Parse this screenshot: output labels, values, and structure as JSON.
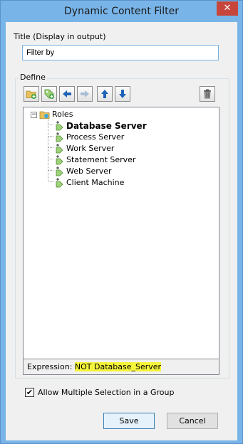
{
  "window": {
    "title": "Dynamic Content Filter",
    "close_glyph": "✕"
  },
  "title_field": {
    "label": "Title (Display in output)",
    "value": "Filter by"
  },
  "define": {
    "label": "Define",
    "toolbar": [
      {
        "name": "add-folder-button",
        "icon": "folder-add-icon"
      },
      {
        "name": "add-item-button",
        "icon": "tag-add-icon"
      },
      {
        "name": "move-left-button",
        "icon": "arrow-left-icon"
      },
      {
        "name": "move-right-button",
        "icon": "arrow-right-icon"
      },
      {
        "name": "move-up-button",
        "icon": "arrow-up-icon"
      },
      {
        "name": "move-down-button",
        "icon": "arrow-down-icon"
      },
      {
        "name": "delete-button",
        "icon": "trash-icon"
      }
    ],
    "tree": {
      "root": {
        "label": "Roles",
        "expander": "−"
      },
      "children": [
        {
          "label": "Database Server",
          "selected": true
        },
        {
          "label": "Process Server"
        },
        {
          "label": "Work Server"
        },
        {
          "label": "Statement Server"
        },
        {
          "label": "Web Server"
        },
        {
          "label": "Client Machine"
        }
      ]
    },
    "expression": {
      "label": "Expression: ",
      "value": "NOT Database_Server"
    }
  },
  "allow_multiple": {
    "label": "Allow Multiple Selection in a Group",
    "checked": true,
    "check_glyph": "✔"
  },
  "buttons": {
    "save": "Save",
    "cancel": "Cancel"
  },
  "colors": {
    "accent": "#78b4e8",
    "highlight": "#f5f53a",
    "close": "#c7463c"
  }
}
